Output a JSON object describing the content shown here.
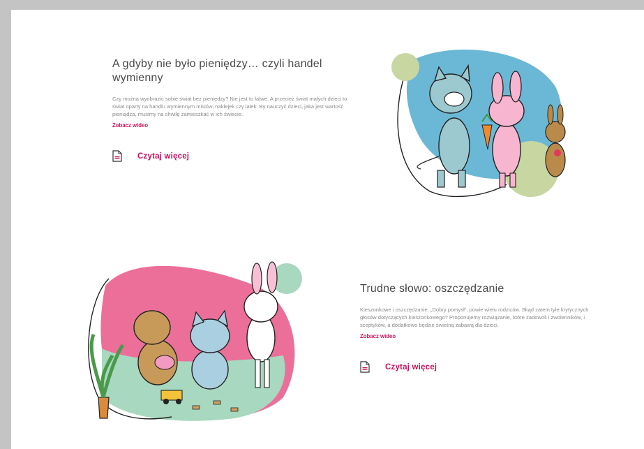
{
  "articles": [
    {
      "title": "A gdyby nie było pieniędzy… czyli handel wymienny",
      "description": "Czy można wyobrazić sobie świat bez pieniędzy? Nie jest to łatwe. A przecież świat małych dzieci to świat oparty na handlu wymiennym misiów, naklejek czy lalek. By nauczyć dzieci, jaka jest wartość pieniądza, musimy na chwilę zamieszkać w ich świecie.",
      "video_link": "Zobacz wideo",
      "read_more": "Czytaj więcej",
      "doc_icon": "document-icon"
    },
    {
      "title": "Trudne słowo: oszczędzanie",
      "description": "Kieszonkowe i oszczędzanie. „Dobry pomysł”, powie wielu rodziców. Skąd zatem tyle krytycznych głosów dotyczących kieszonkowego? Proponujemy rozwiązanie, które zadowoli i zwolenników, i sceptyków, a dodatkowo będzie świetną zabawą dla dzieci.",
      "video_link": "Zobacz wideo",
      "read_more": "Czytaj więcej",
      "doc_icon": "document-icon"
    }
  ],
  "colors": {
    "accent": "#c8105a",
    "blob_blue": "#6bb8d6",
    "blob_green": "#c8d6a2",
    "blob_pink": "#ec6f9a",
    "blob_mint": "#a8d8bf",
    "page_bg": "#c4c4c4"
  }
}
